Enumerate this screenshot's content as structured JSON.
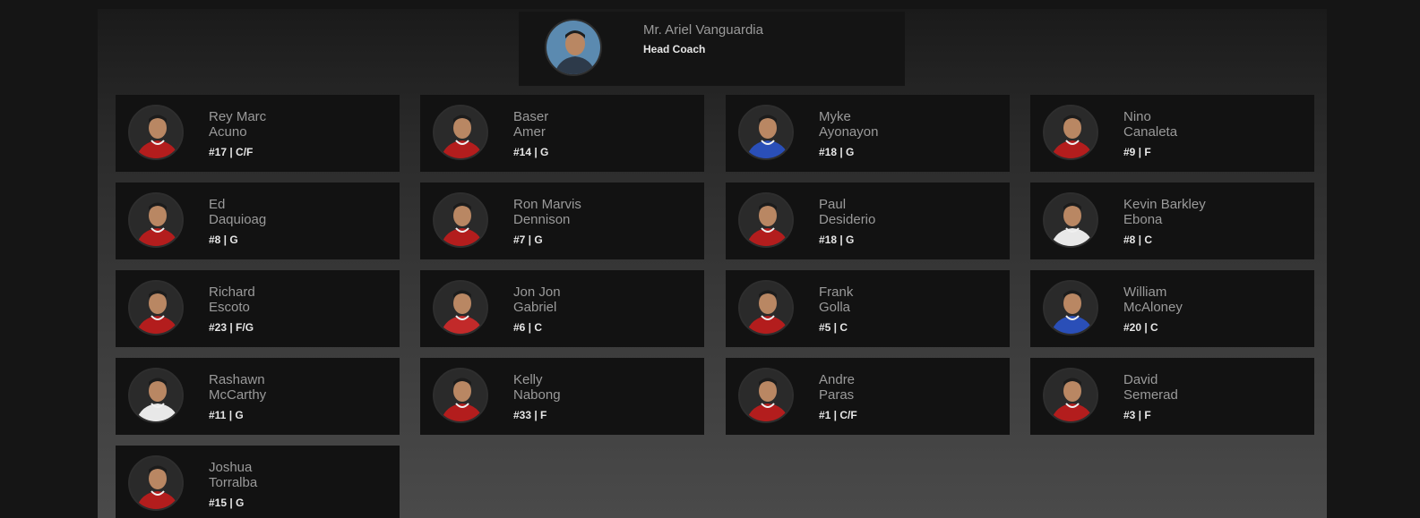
{
  "coach": {
    "name": "Mr. Ariel Vanguardia",
    "role": "Head Coach",
    "jersey_color": "#2d3a4a"
  },
  "players": [
    {
      "name": "Rey Marc\nAcuno",
      "meta": "#17 | C/F",
      "jersey_color": "#b31d1d"
    },
    {
      "name": "Baser\nAmer",
      "meta": "#14 | G",
      "jersey_color": "#b31d1d"
    },
    {
      "name": "Myke\nAyonayon",
      "meta": "#18 | G",
      "jersey_color": "#2a4fb8"
    },
    {
      "name": "Nino\nCanaleta",
      "meta": "#9 | F",
      "jersey_color": "#b31d1d"
    },
    {
      "name": "Ed\nDaquioag",
      "meta": "#8 | G",
      "jersey_color": "#b31d1d"
    },
    {
      "name": "Ron Marvis\nDennison",
      "meta": "#7 | G",
      "jersey_color": "#b31d1d"
    },
    {
      "name": "Paul\nDesiderio",
      "meta": "#18 | G",
      "jersey_color": "#b31d1d"
    },
    {
      "name": "Kevin Barkley\nEbona",
      "meta": "#8 | C",
      "jersey_color": "#e8e8e8"
    },
    {
      "name": "Richard\nEscoto",
      "meta": "#23 | F/G",
      "jersey_color": "#b31d1d"
    },
    {
      "name": "Jon Jon\nGabriel",
      "meta": "#6 | C",
      "jersey_color": "#c22a2a"
    },
    {
      "name": "Frank\nGolla",
      "meta": "#5 | C",
      "jersey_color": "#b31d1d"
    },
    {
      "name": "William\nMcAloney",
      "meta": "#20 | C",
      "jersey_color": "#2a4fb8"
    },
    {
      "name": "Rashawn\nMcCarthy",
      "meta": "#11 | G",
      "jersey_color": "#e8e8e8"
    },
    {
      "name": "Kelly\nNabong",
      "meta": "#33 | F",
      "jersey_color": "#b31d1d"
    },
    {
      "name": "Andre\nParas",
      "meta": "#1 | C/F",
      "jersey_color": "#b31d1d"
    },
    {
      "name": "David\nSemerad",
      "meta": "#3 | F",
      "jersey_color": "#b31d1d"
    },
    {
      "name": "Joshua\nTorralba",
      "meta": "#15 | G",
      "jersey_color": "#b31d1d"
    }
  ]
}
